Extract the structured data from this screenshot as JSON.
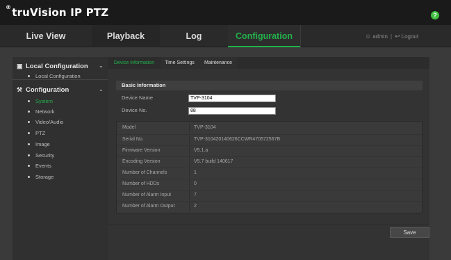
{
  "brand": {
    "reg_mark": "®",
    "title": "truVision  IP PTZ",
    "help_symbol": "?"
  },
  "nav": {
    "tabs": [
      {
        "label": "Live View"
      },
      {
        "label": "Playback"
      },
      {
        "label": "Log"
      },
      {
        "label": "Configuration"
      }
    ],
    "user": "admin",
    "logout": "Logout",
    "active_color": "#22b14c"
  },
  "sidebar": {
    "local_title": "Local Configuration",
    "local_items": [
      "Local Configuration"
    ],
    "config_title": "Configuration",
    "config_items": [
      "System",
      "Network",
      "Video/Audio",
      "PTZ",
      "Image",
      "Security",
      "Events",
      "Storage"
    ],
    "active_item": "System"
  },
  "subtabs": [
    "Device Information",
    "Time Settings",
    "Maintenance"
  ],
  "basic": {
    "header": "Basic Information",
    "device_name_label": "Device Name",
    "device_name_value": "TVP-3104",
    "device_no_label": "Device No.",
    "device_no_value": "88"
  },
  "info": [
    {
      "key": "Model",
      "value": "TVP-3104"
    },
    {
      "key": "Serial No.",
      "value": "TVP-310420140626CCWR470572567B"
    },
    {
      "key": "Firmware Version",
      "value": "V5.1.a"
    },
    {
      "key": "Encoding Version",
      "value": "V5.7 build 140617"
    },
    {
      "key": "Number of Channels",
      "value": "1"
    },
    {
      "key": "Number of HDDs",
      "value": "0"
    },
    {
      "key": "Number of Alarm Input",
      "value": "7"
    },
    {
      "key": "Number of Alarm Output",
      "value": "2"
    }
  ],
  "save_label": "Save"
}
